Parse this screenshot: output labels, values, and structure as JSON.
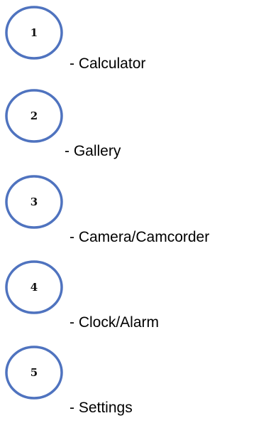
{
  "colors": {
    "ring": "#4f73bf",
    "text": "#000000",
    "background": "#ffffff"
  },
  "items": [
    {
      "number": "1",
      "label": "- Calculator"
    },
    {
      "number": "2",
      "label": "- Gallery"
    },
    {
      "number": "3",
      "label": "- Camera/Camcorder"
    },
    {
      "number": "4",
      "label": "- Clock/Alarm"
    },
    {
      "number": "5",
      "label": "- Settings"
    }
  ]
}
